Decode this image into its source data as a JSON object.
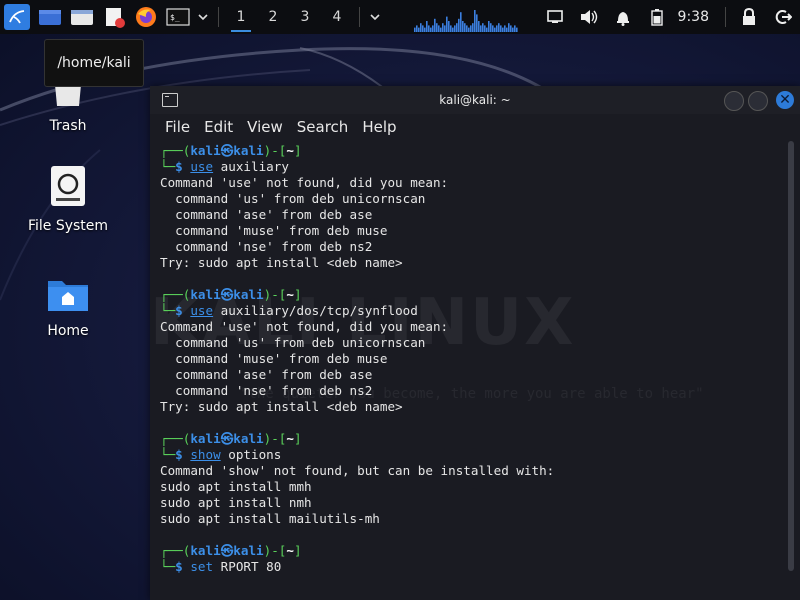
{
  "panel": {
    "workspaces": [
      "1",
      "2",
      "3",
      "4"
    ],
    "active_workspace": 0,
    "clock": "9:38",
    "icons": [
      "kali-menu-icon",
      "show-desktop-icon",
      "file-manager-icon",
      "text-editor-icon",
      "firefox-icon",
      "terminal-icon",
      "chevron-down-icon",
      "network-icon",
      "volume-icon",
      "notification-bell-icon",
      "battery-icon",
      "lock-icon",
      "logout-icon"
    ]
  },
  "tooltip": "/home/kali",
  "desktop": {
    "icons": [
      {
        "label": "Trash"
      },
      {
        "label": "File System"
      },
      {
        "label": "Home"
      }
    ]
  },
  "colors": {
    "accent": "#2f7de1",
    "prompt_blue": "#3c8fe8",
    "prompt_green": "#5ad15a",
    "terminal_bg": "#1a1b22"
  },
  "terminal": {
    "title": "kali@kali: ~",
    "menu": [
      "File",
      "Edit",
      "View",
      "Search",
      "Help"
    ],
    "prompt": {
      "user": "kali",
      "host": "kali",
      "dir": "~"
    },
    "blocks": [
      {
        "command": "use",
        "args": " auxiliary",
        "output": [
          "Command 'use' not found, did you mean:",
          "  command 'us' from deb unicornscan",
          "  command 'ase' from deb ase",
          "  command 'muse' from deb muse",
          "  command 'nse' from deb ns2",
          "Try: sudo apt install <deb name>",
          ""
        ]
      },
      {
        "command": "use",
        "args": " auxiliary/dos/tcp/synflood",
        "output": [
          "Command 'use' not found, did you mean:",
          "  command 'us' from deb unicornscan",
          "  command 'muse' from deb muse",
          "  command 'ase' from deb ase",
          "  command 'nse' from deb ns2",
          "Try: sudo apt install <deb name>",
          ""
        ]
      },
      {
        "command": "show",
        "args": " options",
        "output": [
          "Command 'show' not found, but can be installed with:",
          "sudo apt install mmh",
          "sudo apt install nmh",
          "sudo apt install mailutils-mh",
          ""
        ]
      },
      {
        "command": "set",
        "args": " RPORT 80",
        "output": []
      }
    ]
  },
  "wallpaper": {
    "logo_text": "KALI LINUX",
    "tagline": "\"the quieter you become, the more you are able to hear\""
  }
}
